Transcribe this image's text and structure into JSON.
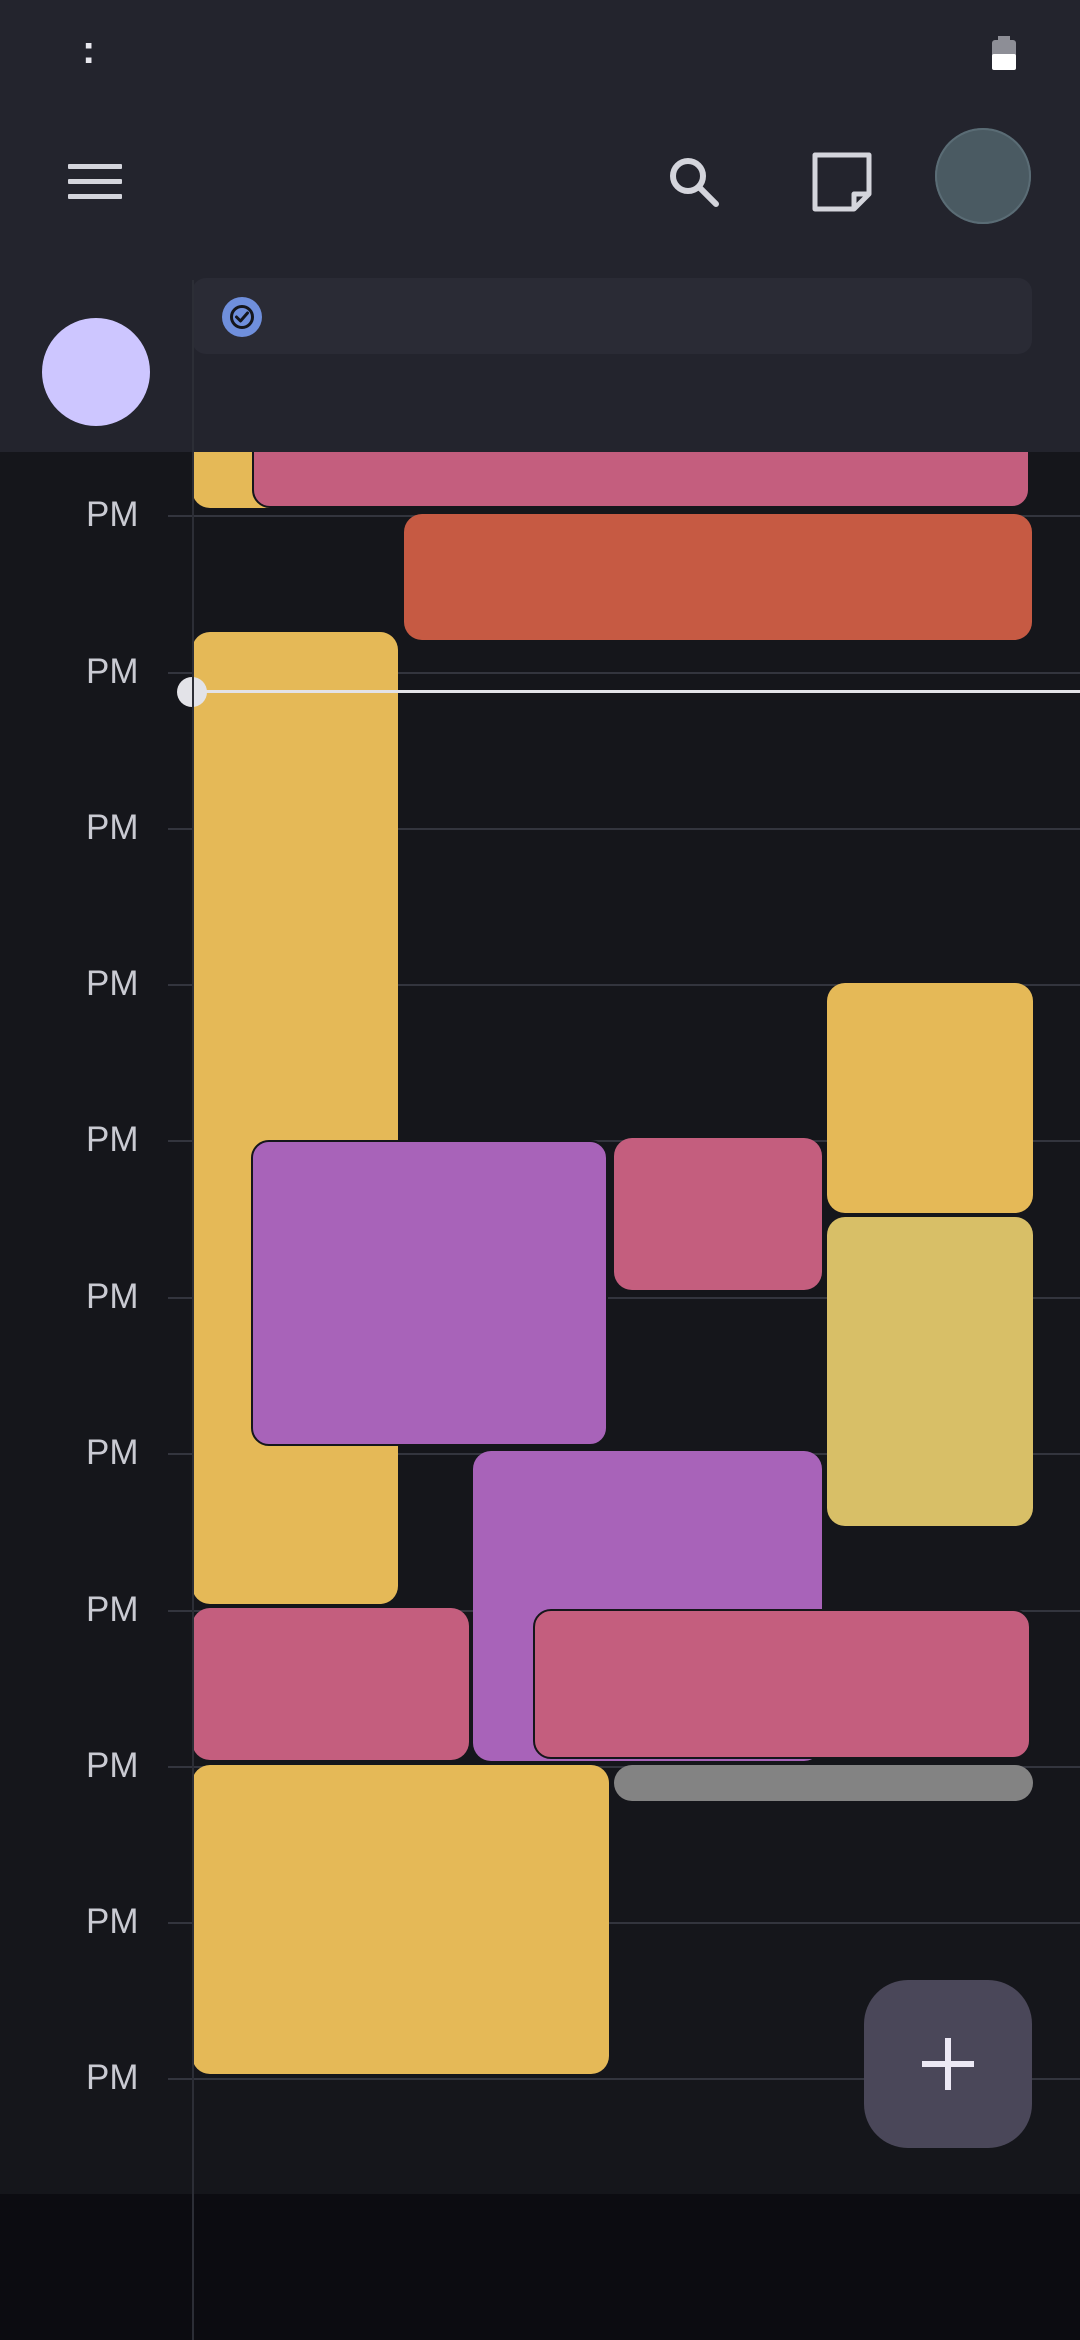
{
  "status_bar": {
    "time_glyph": ":",
    "battery_icon": "battery-icon"
  },
  "app_bar": {
    "menu_icon": "hamburger-menu-icon",
    "search_icon": "search-icon",
    "tasks_icon": "tasks-note-icon",
    "account_icon": "account-avatar",
    "allday_icon": "task-check-icon"
  },
  "hours": [
    "PM",
    "PM",
    "PM",
    "PM",
    "PM",
    "PM",
    "PM",
    "PM",
    "PM",
    "PM",
    "PM"
  ],
  "colors": {
    "banana": "#e5b957",
    "flamingo": "#c45e7e",
    "tangerine": "#c65a43",
    "grape": "#a863b9",
    "citron": "#d8bf67",
    "graphite": "#838383",
    "now_line": "#e3e3e8",
    "fab": "#4a4759"
  },
  "fab": {
    "icon": "plus-icon"
  }
}
